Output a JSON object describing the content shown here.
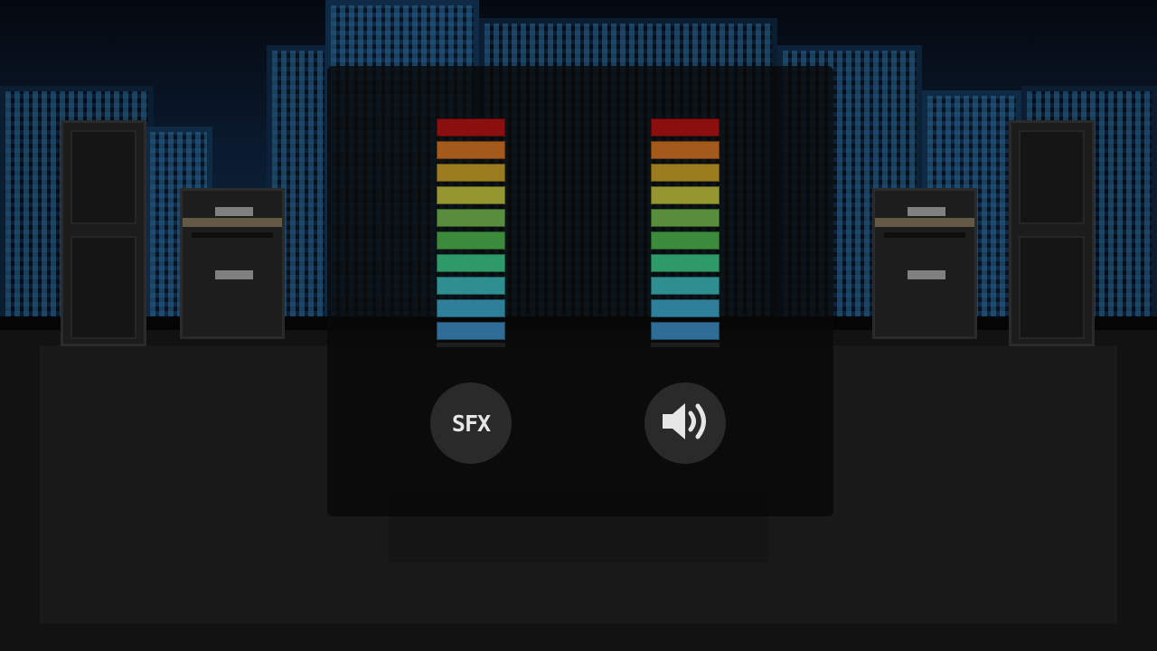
{
  "volume_meters": [
    {
      "id": "sfx",
      "level": 1.0,
      "segment_colors": [
        "#2f6d97",
        "#2e7f99",
        "#2f8e8f",
        "#2e9a6a",
        "#3c8a3c",
        "#578d3d",
        "#94962f",
        "#9a7b1d",
        "#a35a1a",
        "#8b0f0f"
      ]
    },
    {
      "id": "music",
      "level": 1.0,
      "segment_colors": [
        "#2f6d97",
        "#2e7f99",
        "#2f8e8f",
        "#2e9a6a",
        "#3c8a3c",
        "#578d3d",
        "#94962f",
        "#9a7b1d",
        "#a35a1a",
        "#8b0f0f"
      ]
    }
  ],
  "buttons": {
    "sfx_label": "SFX",
    "music_icon": "speaker-volume-icon"
  }
}
